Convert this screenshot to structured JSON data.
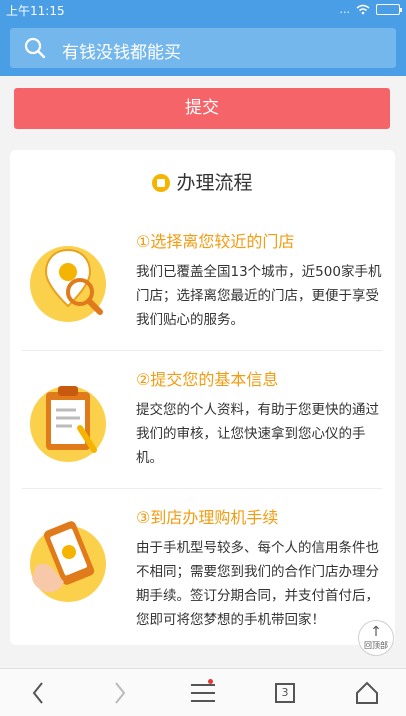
{
  "statusbar": {
    "time": "上午11:15",
    "signal": "...",
    "wifi": "WiFi"
  },
  "search": {
    "placeholder": "有钱没钱都能买"
  },
  "submit_label": "提交",
  "process": {
    "title": "办理流程",
    "steps": [
      {
        "title": "①选择离您较近的门店",
        "desc": "我们已覆盖全国13个城市，近500家手机门店；选择离您最近的门店，更便于享受我们贴心的服务。",
        "icon": "location-pin-icon"
      },
      {
        "title": "②提交您的基本信息",
        "desc": "提交您的个人资料，有助于您更快的通过我们的审核，让您快速拿到您心仪的手机。",
        "icon": "clipboard-icon"
      },
      {
        "title": "③到店办理购机手续",
        "desc": "由于手机型号较多、每个人的信用条件也不相同；需要您到我们的合作门店办理分期手续。签订分期合同，并支付首付后，您即可将您梦想的手机带回家！",
        "icon": "hand-phone-icon"
      }
    ]
  },
  "back_to_top": "回顶部",
  "toolbar": {
    "tab_count": "3"
  },
  "colors": {
    "header": "#4a9ee6",
    "submit": "#f56469",
    "accent": "#f39c12"
  }
}
